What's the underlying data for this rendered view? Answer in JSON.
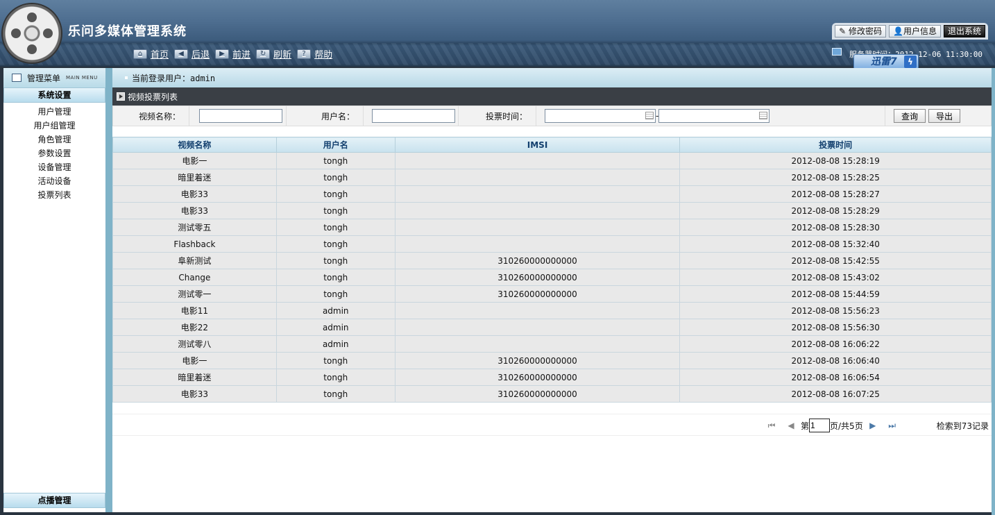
{
  "app": {
    "title": "乐问多媒体管理系统"
  },
  "nav": [
    {
      "label": "首页",
      "icon": "home-icon",
      "glyph": "⌂"
    },
    {
      "label": "后退",
      "icon": "back-icon",
      "glyph": "◀"
    },
    {
      "label": "前进",
      "icon": "forward-icon",
      "glyph": "▶"
    },
    {
      "label": "刷新",
      "icon": "refresh-icon",
      "glyph": "↻"
    },
    {
      "label": "帮助",
      "icon": "help-icon",
      "glyph": "?"
    }
  ],
  "user_buttons": {
    "change_password": "修改密码",
    "user_info": "用户信息",
    "logout": "退出系统"
  },
  "server_time": "服务器时间：2012-12-06 11:30:00",
  "xunlei": {
    "label": "迅雷7",
    "bolt": "ϟ"
  },
  "sidebar": {
    "header": "管理菜单",
    "header_en": "MAIN MENU",
    "section": "系统设置",
    "items": [
      "用户管理",
      "用户组管理",
      "角色管理",
      "参数设置",
      "设备管理",
      "活动设备",
      "投票列表"
    ],
    "bottom_section": "点播管理"
  },
  "login": {
    "text": "当前登录用户：admin"
  },
  "section_title": "视频投票列表",
  "search": {
    "video_name_label": "视频名称：",
    "user_name_label": "用户名：",
    "vote_time_label": "投票时间：",
    "range_sep": "-",
    "query": "查询",
    "export": "导出"
  },
  "table": {
    "columns": [
      "视频名称",
      "用户名",
      "IMSI",
      "投票时间"
    ],
    "rows": [
      [
        "电影一",
        "tongh",
        "",
        "2012-08-08 15:28:19"
      ],
      [
        "暗里着迷",
        "tongh",
        "",
        "2012-08-08 15:28:25"
      ],
      [
        "电影33",
        "tongh",
        "",
        "2012-08-08 15:28:27"
      ],
      [
        "电影33",
        "tongh",
        "",
        "2012-08-08 15:28:29"
      ],
      [
        "测试零五",
        "tongh",
        "",
        "2012-08-08 15:28:30"
      ],
      [
        "Flashback",
        "tongh",
        "",
        "2012-08-08 15:32:40"
      ],
      [
        "阜新测试",
        "tongh",
        "310260000000000",
        "2012-08-08 15:42:55"
      ],
      [
        "Change",
        "tongh",
        "310260000000000",
        "2012-08-08 15:43:02"
      ],
      [
        "测试零一",
        "tongh",
        "310260000000000",
        "2012-08-08 15:44:59"
      ],
      [
        "电影11",
        "admin",
        "",
        "2012-08-08 15:56:23"
      ],
      [
        "电影22",
        "admin",
        "",
        "2012-08-08 15:56:30"
      ],
      [
        "测试零八",
        "admin",
        "",
        "2012-08-08 16:06:22"
      ],
      [
        "电影一",
        "tongh",
        "310260000000000",
        "2012-08-08 16:06:40"
      ],
      [
        "暗里着迷",
        "tongh",
        "310260000000000",
        "2012-08-08 16:06:54"
      ],
      [
        "电影33",
        "tongh",
        "310260000000000",
        "2012-08-08 16:07:25"
      ]
    ]
  },
  "pager": {
    "prefix": "第",
    "current": "1",
    "suffix": "页/共5页",
    "first": "⏮",
    "prev": "◀",
    "next": "▶",
    "last": "⏭",
    "total": "检索到73记录"
  }
}
